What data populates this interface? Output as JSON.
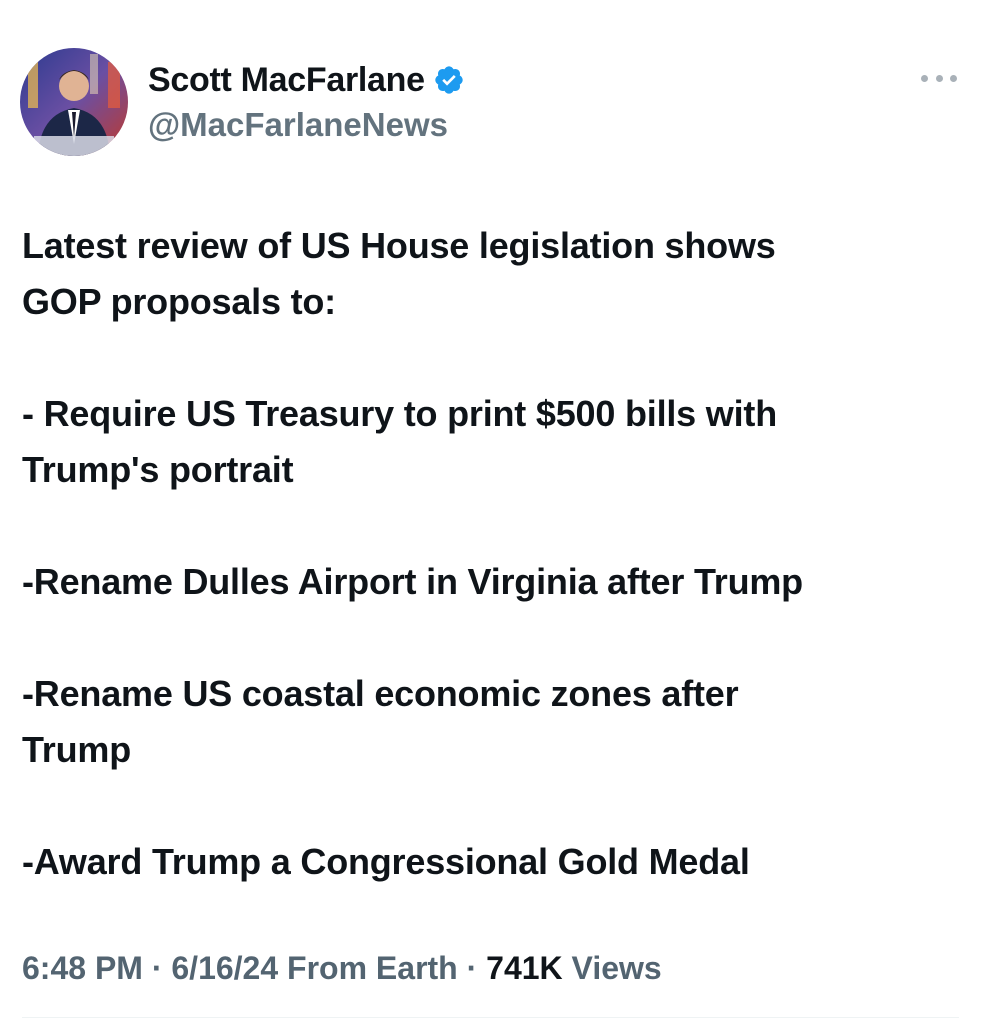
{
  "author": {
    "display_name": "Scott MacFarlane",
    "handle": "@MacFarlaneNews",
    "verified": true,
    "verified_color": "#1d9bf0"
  },
  "tweet": {
    "intro_line1": "Latest review of US House legislation shows",
    "intro_line2": "GOP proposals to:",
    "item1_line1": "- Require US Treasury to print $500 bills with",
    "item1_line2": "Trump's portrait",
    "item2": "-Rename Dulles Airport in Virginia after Trump",
    "item3_line1": "-Rename US coastal economic zones after",
    "item3_line2": "Trump",
    "item4": "-Award Trump a Congressional Gold Medal"
  },
  "meta": {
    "time": "6:48 PM",
    "sep1": " · ",
    "date": "6/16/24",
    "source": " From Earth",
    "sep2": " · ",
    "views_count": "741K",
    "views_label": " Views"
  },
  "icons": {
    "more": "more-horizontal-icon",
    "verified": "verified-badge-icon"
  }
}
